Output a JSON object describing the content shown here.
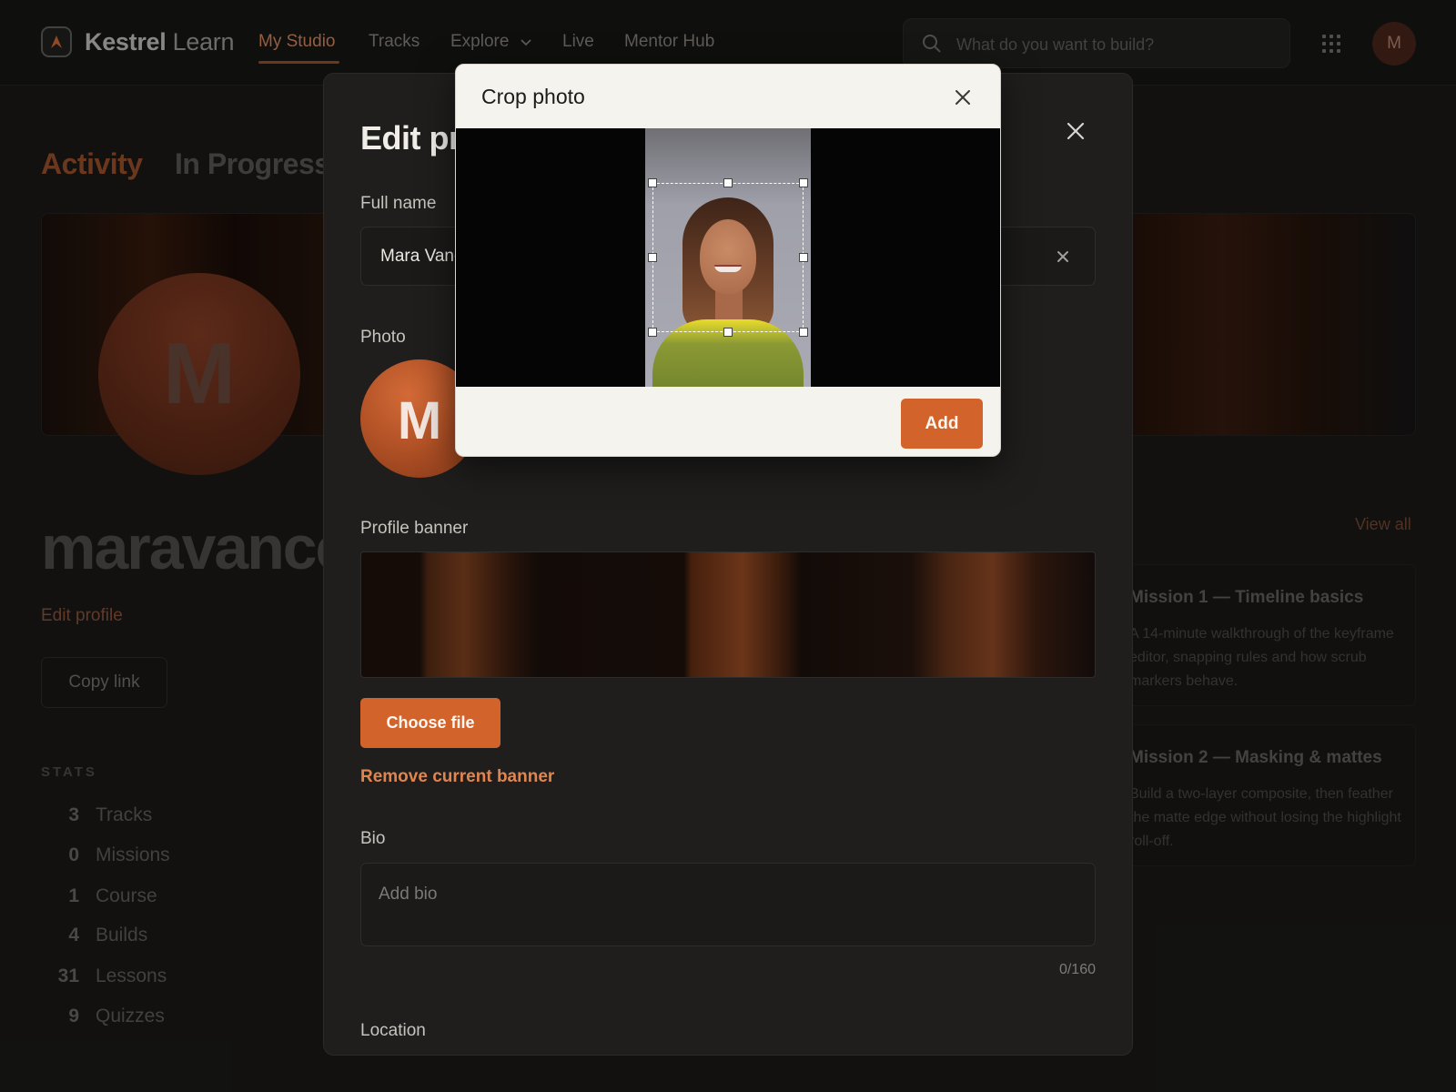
{
  "app": {
    "brand_bold": "Kestrel",
    "brand_light": "Learn",
    "nav": [
      {
        "label": "My Studio",
        "active": true
      },
      {
        "label": "Tracks"
      },
      {
        "label": "Explore",
        "has_dropdown": true
      },
      {
        "label": "Live"
      },
      {
        "label": "Mentor Hub"
      }
    ],
    "search_placeholder": "What do you want to build?",
    "user_initial": "M",
    "accent_color": "#d2632a"
  },
  "profile_page": {
    "tabs": [
      "Activity",
      "In Progress"
    ],
    "avatar_initial": "M",
    "username": "maravance",
    "edit_profile_link": "Edit profile",
    "copy_link_button": "Copy link",
    "stats_title": "STATS",
    "stats": [
      {
        "count": "3",
        "label": "Tracks"
      },
      {
        "count": "0",
        "label": "Missions"
      },
      {
        "count": "1",
        "label": "Course"
      },
      {
        "count": "4",
        "label": "Builds"
      },
      {
        "count": "31",
        "label": "Lessons"
      },
      {
        "count": "9",
        "label": "Quizzes"
      }
    ],
    "view_all": "View all",
    "missions": [
      {
        "title": "Mission 1 — Timeline basics",
        "desc": "A 14-minute walkthrough of the keyframe editor, snapping rules and how scrub markers behave."
      },
      {
        "title": "Mission 2 — Masking & mattes",
        "desc": "Build a two-layer composite, then feather the matte edge without losing the highlight roll-off."
      }
    ]
  },
  "edit_modal": {
    "title": "Edit profile",
    "full_name_label": "Full name",
    "full_name_value": "Mara Vance",
    "photo_label": "Photo",
    "photo_initial": "M",
    "banner_label": "Profile banner",
    "choose_file_button": "Choose file",
    "remove_banner_link": "Remove current banner",
    "bio_label": "Bio",
    "bio_placeholder": "Add bio",
    "bio_count": "0/160",
    "location_label": "Location"
  },
  "crop_modal": {
    "title": "Crop photo",
    "add_button": "Add"
  }
}
